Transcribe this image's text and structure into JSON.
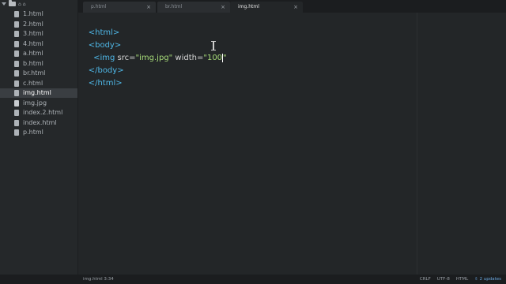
{
  "sidebar": {
    "root_label": "⌂ ⌂",
    "files": [
      {
        "name": "1.html",
        "icon": "file-icon",
        "selected": false
      },
      {
        "name": "2.html",
        "icon": "file-icon",
        "selected": false
      },
      {
        "name": "3.html",
        "icon": "file-icon",
        "selected": false
      },
      {
        "name": "4.html",
        "icon": "file-icon",
        "selected": false
      },
      {
        "name": "a.html",
        "icon": "file-icon",
        "selected": false
      },
      {
        "name": "b.html",
        "icon": "file-icon",
        "selected": false
      },
      {
        "name": "br.html",
        "icon": "file-icon",
        "selected": false
      },
      {
        "name": "c.html",
        "icon": "file-icon",
        "selected": false
      },
      {
        "name": "img.html",
        "icon": "file-icon",
        "selected": true
      },
      {
        "name": "img.jpg",
        "icon": "image-file-icon",
        "selected": false
      },
      {
        "name": "index.2.html",
        "icon": "file-icon",
        "selected": false
      },
      {
        "name": "index.html",
        "icon": "file-icon",
        "selected": false
      },
      {
        "name": "p.html",
        "icon": "file-icon",
        "selected": false
      }
    ]
  },
  "tabs": [
    {
      "label": "p.html",
      "close": "×",
      "active": false
    },
    {
      "label": "br.html",
      "close": "×",
      "active": false
    },
    {
      "label": "img.html",
      "close": "×",
      "active": true
    }
  ],
  "editor": {
    "lines": [
      {
        "open": "<",
        "tag": "html",
        "close": ">"
      },
      {
        "open": "<",
        "tag": "body",
        "close": ">"
      },
      {
        "indent": "  ",
        "open": "<",
        "tag": "img",
        "src_attr": " src=",
        "src_val": "\"img.jpg\"",
        "width_attr": " width=",
        "width_val": "\"100",
        "after_cursor": "\""
      },
      {
        "open": "</",
        "tag": "body",
        "close": ">"
      },
      {
        "open": "</",
        "tag": "html",
        "close": ">"
      }
    ],
    "colors": {
      "bracket": "#4fb8e8",
      "string": "#a6da78",
      "attribute": "#d6d6d6",
      "background": "#232628"
    }
  },
  "status": {
    "file": "img.html",
    "position": "3:34",
    "line_ending": "CRLF",
    "encoding": "UTF-8",
    "grammar": "HTML",
    "updates": "⇩ 2 updates"
  }
}
